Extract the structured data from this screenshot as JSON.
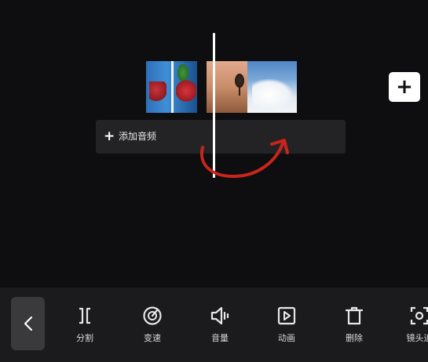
{
  "timeline": {
    "audio_track_label": "添加音频"
  },
  "toolbar": {
    "tools": [
      {
        "label": "分割",
        "icon": "split-icon"
      },
      {
        "label": "变速",
        "icon": "speed-icon"
      },
      {
        "label": "音量",
        "icon": "volume-icon"
      },
      {
        "label": "动画",
        "icon": "animation-icon"
      },
      {
        "label": "删除",
        "icon": "delete-icon"
      },
      {
        "label": "镜头追",
        "icon": "camera-track-icon"
      }
    ]
  },
  "colors": {
    "background": "#0e0e10",
    "toolbar": "#1b1b1d",
    "annotation_arrow": "#c8251c",
    "playhead": "#ffffff"
  }
}
